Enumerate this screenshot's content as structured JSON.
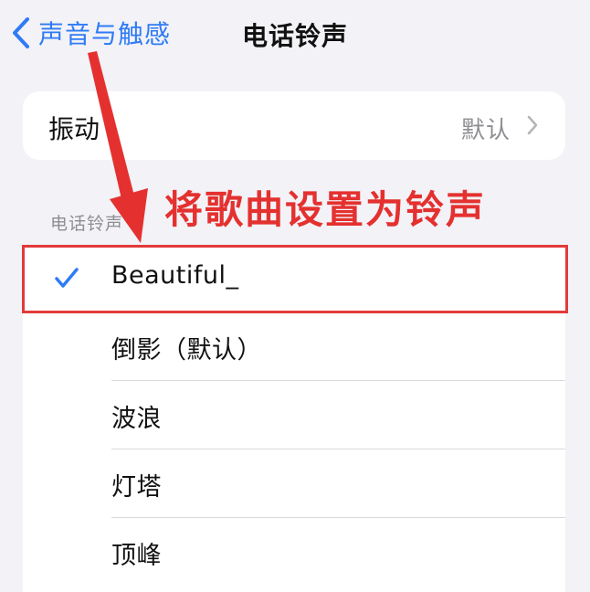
{
  "navbar": {
    "back_label": "声音与触感",
    "title": "电话铃声"
  },
  "vibration": {
    "label": "振动",
    "value": "默认"
  },
  "ringtones": {
    "section_header": "电话铃声",
    "items": [
      {
        "label": "Beautiful_",
        "selected": true
      },
      {
        "label": "倒影（默认）",
        "selected": false
      },
      {
        "label": "波浪",
        "selected": false
      },
      {
        "label": "灯塔",
        "selected": false
      },
      {
        "label": "顶峰",
        "selected": false
      }
    ]
  },
  "annotation": {
    "text": "将歌曲设置为铃声",
    "color": "#e4312f"
  },
  "colors": {
    "accent": "#2f7bf6",
    "annotation_red": "#e23a3a",
    "background": "#f2f2f7"
  },
  "icons": {
    "back": "chevron-left-icon",
    "disclosure": "chevron-right-icon",
    "selected": "checkmark-icon",
    "annotation_arrow": "arrow-icon"
  }
}
